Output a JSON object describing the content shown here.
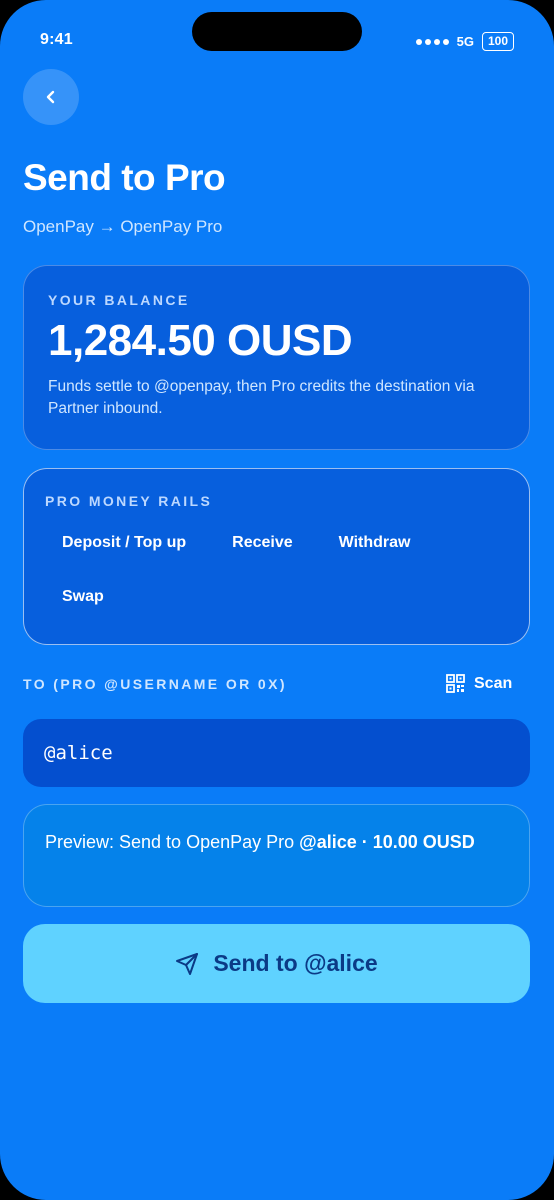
{
  "status": {
    "time": "9:41",
    "network": "5G",
    "battery": "100"
  },
  "header": {
    "back_icon": "chevron-left-icon",
    "title": "Send to Pro",
    "subtitle": "OpenPay → OpenPay Pro"
  },
  "balance": {
    "label": "YOUR BALANCE",
    "amount": "1,284.50 OUSD",
    "note": "Funds settle to @openpay, then Pro credits the destination via Partner inbound."
  },
  "rails": {
    "label": "PRO MONEY RAILS",
    "items": [
      {
        "label": "Deposit / Top up"
      },
      {
        "label": "Receive"
      },
      {
        "label": "Withdraw"
      },
      {
        "label": "Swap"
      }
    ]
  },
  "recipient": {
    "label": "TO (PRO @USERNAME OR 0X)",
    "scan_label": "Scan",
    "scan_icon": "qr-code-icon",
    "value": "@alice"
  },
  "preview": {
    "prefix": "Preview: Send to OpenPay Pro ",
    "emphasis": "@alice · 10.00 OUSD"
  },
  "send_button": {
    "label": "Send to @alice",
    "icon": "send-icon"
  },
  "colors": {
    "background": "#0a7cf8",
    "card": "#075fdd",
    "input": "#044fcf",
    "preview": "#0582ea",
    "accent_button": "#5fd2ff",
    "accent_text": "#0b3a86"
  }
}
